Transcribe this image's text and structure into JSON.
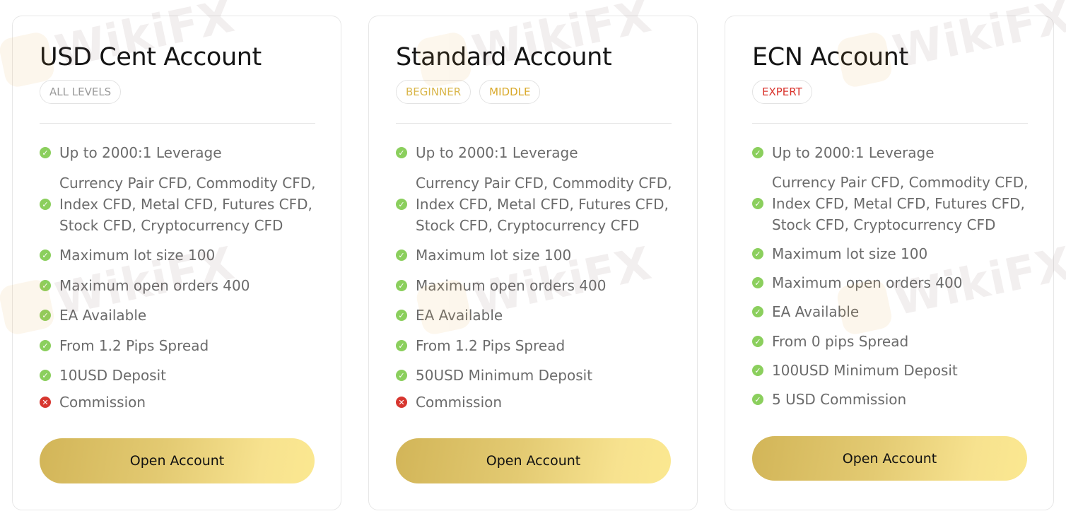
{
  "colors": {
    "check": "#8bcf5d",
    "cross": "#d7362f",
    "tag_all_levels": "#9a9a9a",
    "tag_beginner": "#d9b64a",
    "tag_middle": "#d9a92a",
    "tag_expert": "#d9332c",
    "button_gradient_start": "#d2b558",
    "button_gradient_end": "#fbe890"
  },
  "icons": {
    "included": "check-circle-icon",
    "excluded": "x-circle-icon"
  },
  "watermark": {
    "text": "WikiFX"
  },
  "cards": [
    {
      "title": "USD Cent Account",
      "tags": [
        {
          "label": "ALL LEVELS",
          "color": "#9a9a9a"
        }
      ],
      "features": [
        {
          "text": "Up to 2000:1 Leverage",
          "included": true
        },
        {
          "text": "Currency Pair CFD, Commodity CFD,\nIndex CFD, Metal CFD, Futures CFD,\nStock CFD, Cryptocurrency CFD",
          "included": true
        },
        {
          "text": "Maximum lot size 100",
          "included": true
        },
        {
          "text": "Maximum open orders 400",
          "included": true
        },
        {
          "text": "EA Available",
          "included": true
        },
        {
          "text": "From 1.2 Pips Spread",
          "included": true
        },
        {
          "text": "10USD Deposit",
          "included": true
        },
        {
          "text": "Commission",
          "included": false
        }
      ],
      "button_label": "Open Account"
    },
    {
      "title": "Standard Account",
      "tags": [
        {
          "label": "BEGINNER",
          "color": "#d9b64a"
        },
        {
          "label": "MIDDLE",
          "color": "#d9a92a"
        }
      ],
      "features": [
        {
          "text": "Up to 2000:1 Leverage",
          "included": true
        },
        {
          "text": "Currency Pair CFD, Commodity CFD,\nIndex CFD, Metal CFD, Futures CFD,\nStock CFD, Cryptocurrency CFD",
          "included": true
        },
        {
          "text": "Maximum lot size 100",
          "included": true
        },
        {
          "text": "Maximum open orders 400",
          "included": true
        },
        {
          "text": "EA Available",
          "included": true
        },
        {
          "text": "From 1.2 Pips Spread",
          "included": true
        },
        {
          "text": "50USD Minimum Deposit",
          "included": true
        },
        {
          "text": "Commission",
          "included": false
        }
      ],
      "button_label": "Open Account"
    },
    {
      "title": "ECN Account",
      "tags": [
        {
          "label": "EXPERT",
          "color": "#d9332c"
        }
      ],
      "features": [
        {
          "text": "Up to 2000:1 Leverage",
          "included": true
        },
        {
          "text": "Currency Pair CFD, Commodity CFD,\nIndex CFD, Metal CFD, Futures CFD,\nStock CFD, Cryptocurrency CFD",
          "included": true
        },
        {
          "text": "Maximum lot size 100",
          "included": true
        },
        {
          "text": "Maximum open orders 400",
          "included": true
        },
        {
          "text": "EA Available",
          "included": true
        },
        {
          "text": "From 0 pips Spread",
          "included": true
        },
        {
          "text": "100USD Minimum Deposit",
          "included": true
        },
        {
          "text": "5 USD Commission",
          "included": true
        }
      ],
      "button_label": "Open Account"
    }
  ]
}
